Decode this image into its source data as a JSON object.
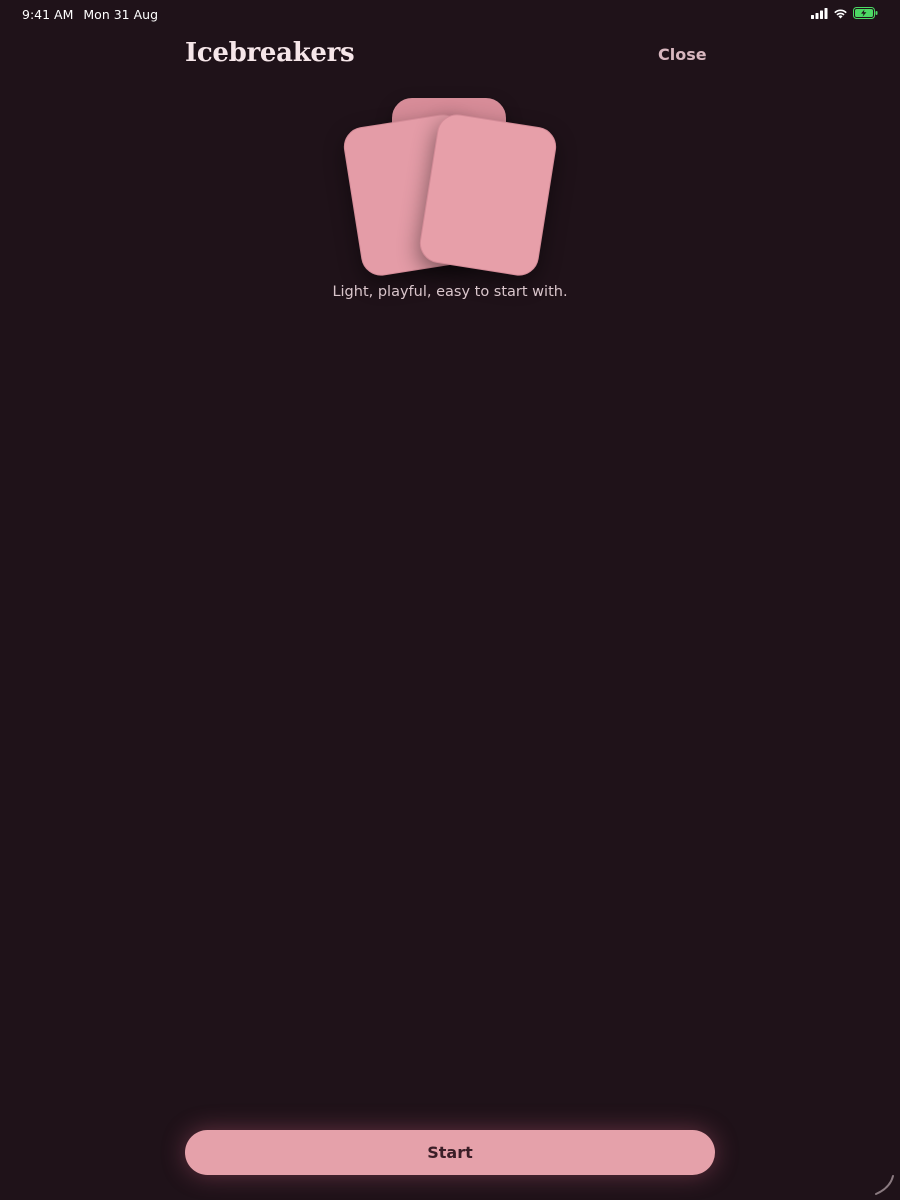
{
  "status_bar": {
    "time": "9:41 AM",
    "date": "Mon 31 Aug",
    "icons": [
      "signal-icon",
      "wifi-icon",
      "battery-charging-icon"
    ],
    "battery_color": "#4cd964"
  },
  "header": {
    "title": "Icebreakers",
    "close_label": "Close"
  },
  "illustration": {
    "icon": "cards-stack-icon",
    "card_color": "#e7a0aa"
  },
  "subtitle": "Light, playful, easy to start with.",
  "start_button": {
    "label": "Start"
  },
  "colors": {
    "background": "#1f1219",
    "accent": "#e5a1aa"
  }
}
